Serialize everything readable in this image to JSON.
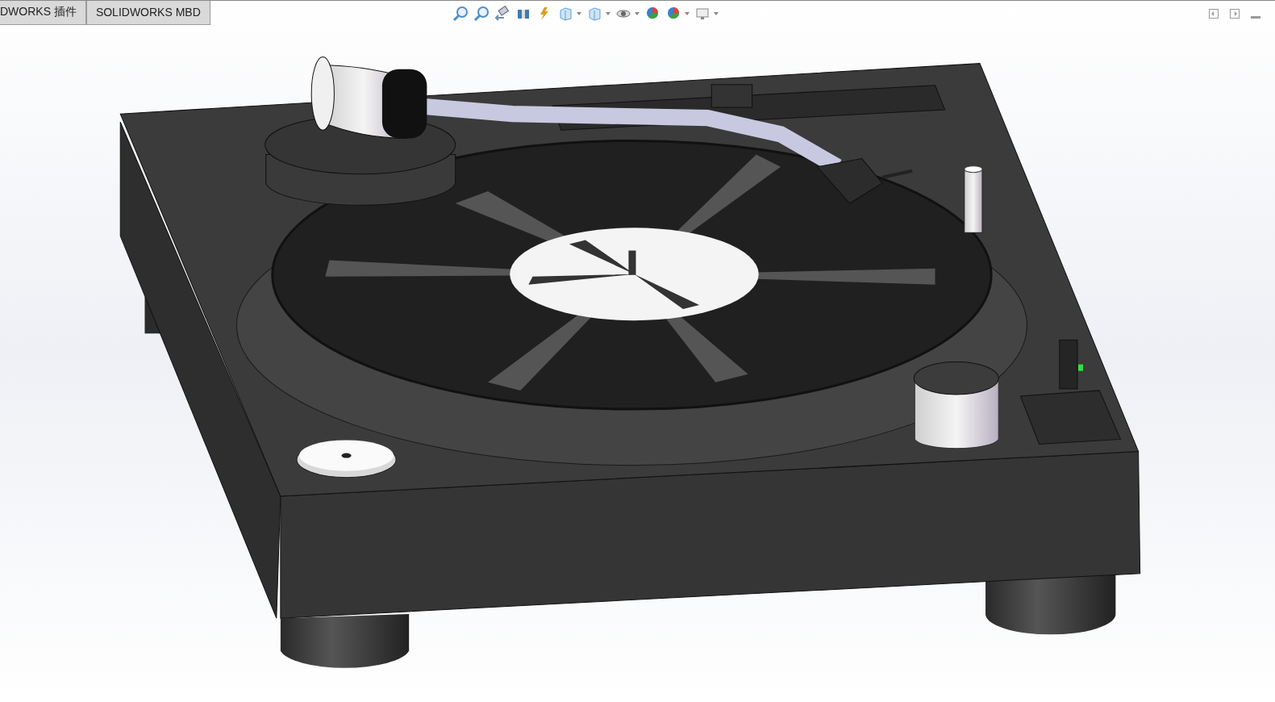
{
  "tabs": [
    {
      "label": "DWORKS 插件",
      "selected": false
    },
    {
      "label": "SOLIDWORKS MBD",
      "selected": false
    }
  ]
}
